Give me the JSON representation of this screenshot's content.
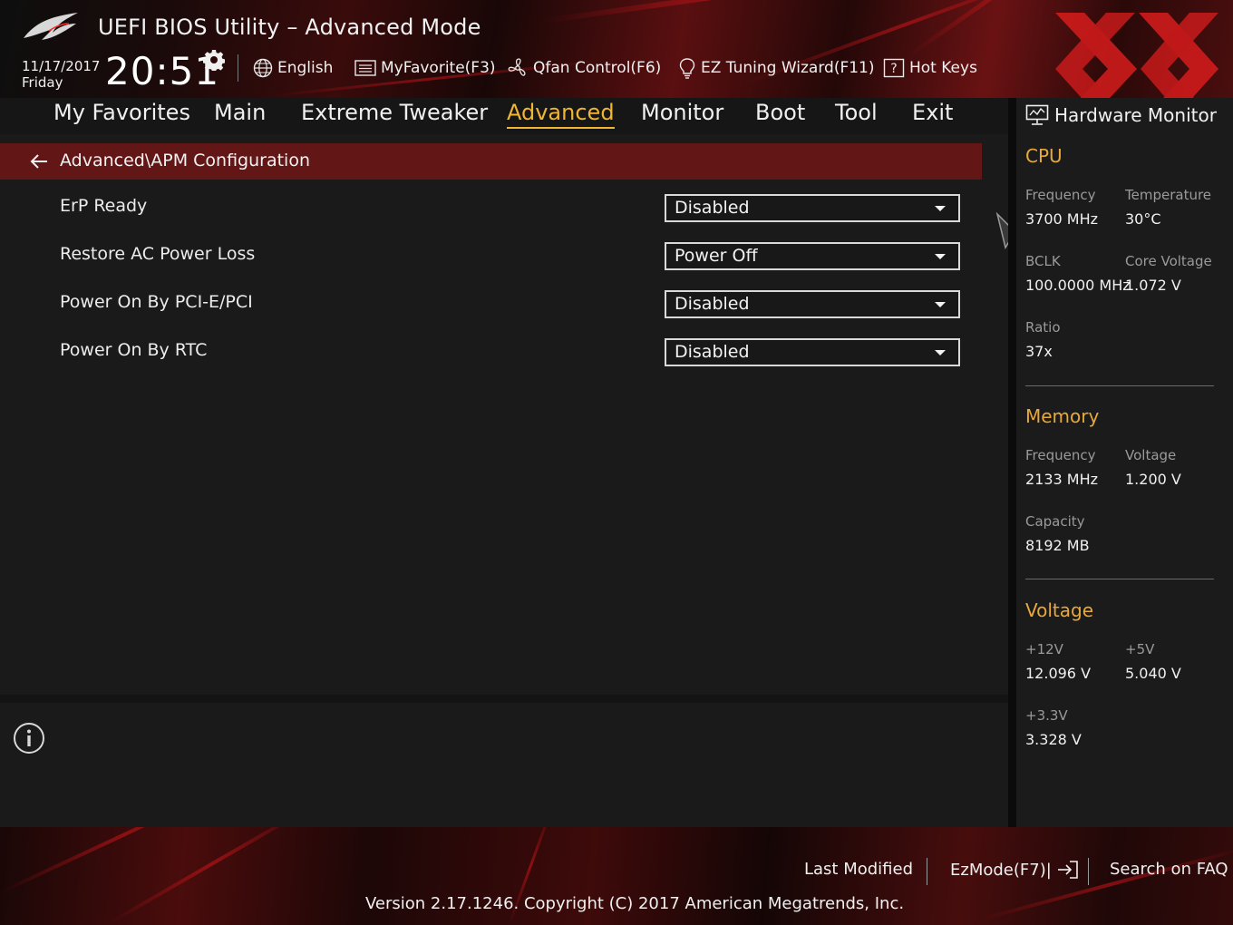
{
  "header": {
    "title": "UEFI BIOS Utility – Advanced Mode",
    "date": "11/17/2017",
    "day": "Friday",
    "time": "20:51",
    "tools": [
      {
        "label": "English"
      },
      {
        "label": "MyFavorite(F3)"
      },
      {
        "label": "Qfan Control(F6)"
      },
      {
        "label": "EZ Tuning Wizard(F11)"
      },
      {
        "label": "Hot Keys"
      }
    ]
  },
  "menu": [
    {
      "label": "My Favorites"
    },
    {
      "label": "Main"
    },
    {
      "label": "Extreme Tweaker"
    },
    {
      "label": "Advanced",
      "active": true
    },
    {
      "label": "Monitor"
    },
    {
      "label": "Boot"
    },
    {
      "label": "Tool"
    },
    {
      "label": "Exit"
    }
  ],
  "breadcrumb": "Advanced\\APM Configuration",
  "settings": [
    {
      "label": "ErP Ready",
      "value": "Disabled"
    },
    {
      "label": "Restore AC Power Loss",
      "value": "Power Off"
    },
    {
      "label": "Power On By PCI-E/PCI",
      "value": "Disabled"
    },
    {
      "label": "Power On By RTC",
      "value": "Disabled"
    }
  ],
  "hw_monitor": {
    "title": "Hardware Monitor",
    "cpu": {
      "heading": "CPU",
      "frequency_label": "Frequency",
      "frequency": "3700 MHz",
      "temperature_label": "Temperature",
      "temperature": "30°C",
      "bclk_label": "BCLK",
      "bclk": "100.0000 MHz",
      "core_voltage_label": "Core Voltage",
      "core_voltage": "1.072 V",
      "ratio_label": "Ratio",
      "ratio": "37x"
    },
    "memory": {
      "heading": "Memory",
      "frequency_label": "Frequency",
      "frequency": "2133 MHz",
      "voltage_label": "Voltage",
      "voltage": "1.200 V",
      "capacity_label": "Capacity",
      "capacity": "8192 MB"
    },
    "voltage": {
      "heading": "Voltage",
      "v12_label": "+12V",
      "v12": "12.096 V",
      "v5_label": "+5V",
      "v5": "5.040 V",
      "v33_label": "+3.3V",
      "v33": "3.328 V"
    }
  },
  "footer": {
    "last_modified": "Last Modified",
    "ezmode": "EzMode(F7)|",
    "search_faq": "Search on FAQ",
    "version": "Version 2.17.1246. Copyright (C) 2017 American Megatrends, Inc."
  },
  "colors": {
    "accent": "#f0b535",
    "section_heading": "#e8a93a",
    "breadcrumb_bg": "#631616",
    "panel_bg": "#1a1a1a"
  },
  "icons": [
    "rog-logo",
    "gear-icon",
    "globe-icon",
    "favorite-list-icon",
    "fan-icon",
    "lightbulb-icon",
    "hotkeys-icon",
    "back-arrow-icon",
    "dropdown-caret-icon",
    "info-icon",
    "monitor-icon",
    "exit-icon",
    "mouse-cursor-icon"
  ]
}
